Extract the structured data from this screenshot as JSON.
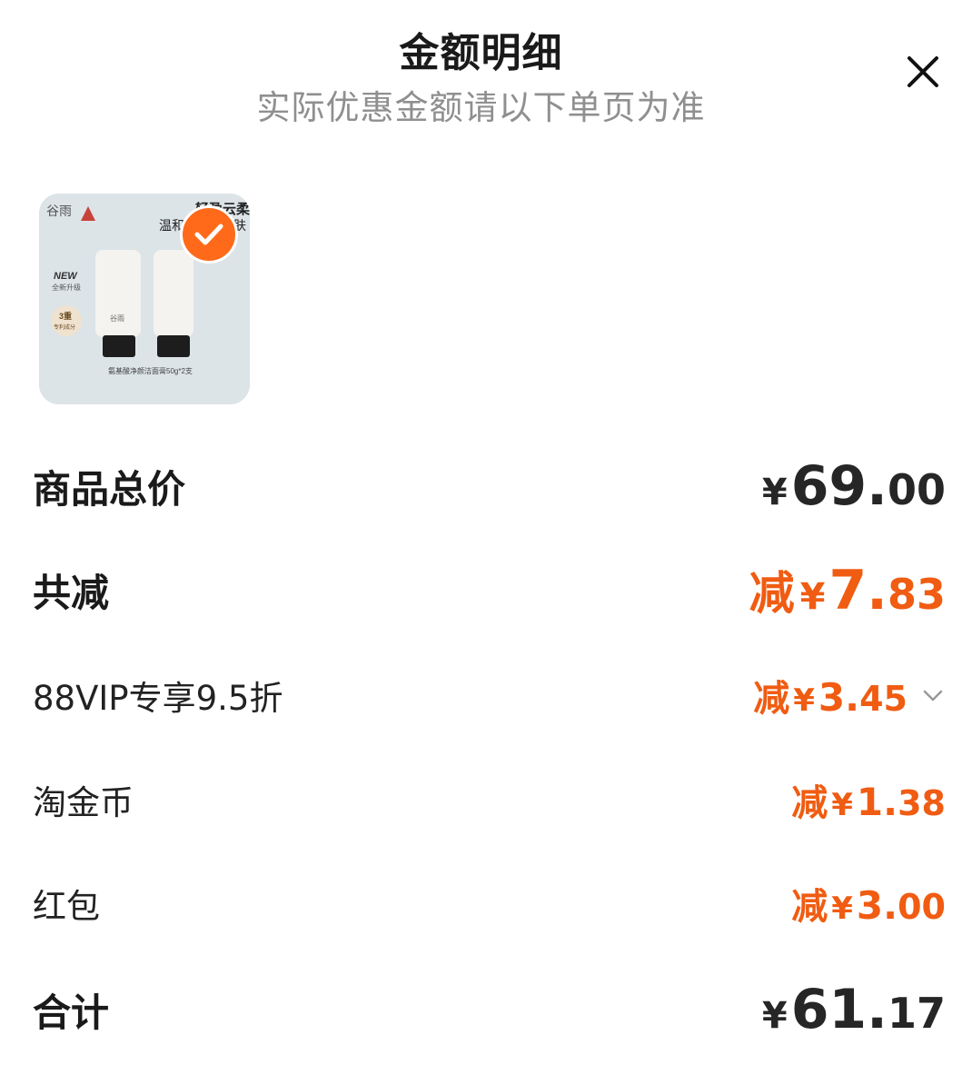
{
  "header": {
    "title": "金额明细",
    "subtitle": "实际优惠金额请以下单页为准"
  },
  "product": {
    "selected": true,
    "image_text": {
      "brand": "谷雨",
      "tagline_1": "轻盈云柔",
      "tagline_2": "温和",
      "tagline_3": "肤",
      "new_badge_1": "NEW",
      "new_badge_2": "全新升级",
      "circle_badge_1": "3重",
      "circle_badge_2": "专利成分",
      "tube_brand": "谷雨",
      "caption": "氨基酸净颜洁面膏50g*2支"
    }
  },
  "summary": {
    "total_price": {
      "label": "商品总价",
      "yen": "¥",
      "int": "69.",
      "dec": "00"
    },
    "total_discount": {
      "label": "共减",
      "prefix": "减",
      "yen": "¥",
      "int": "7.",
      "dec": "83"
    },
    "discounts": [
      {
        "label": "88VIP专享9.5折",
        "prefix": "减",
        "yen": "¥",
        "int": "3.",
        "dec": "45",
        "expandable": true
      },
      {
        "label": "淘金币",
        "prefix": "减",
        "yen": "¥",
        "int": "1.",
        "dec": "38"
      },
      {
        "label": "红包",
        "prefix": "减",
        "yen": "¥",
        "int": "3.",
        "dec": "00"
      }
    ],
    "grand_total": {
      "label": "合计",
      "yen": "¥",
      "int": "61.",
      "dec": "17"
    }
  },
  "colors": {
    "accent_orange": "#f05c12",
    "check_badge": "#ff6a1a",
    "subtitle_gray": "#8f8f8f"
  },
  "icons": {
    "close": "close-icon",
    "check": "check-icon",
    "expand": "chevron-down-icon"
  }
}
